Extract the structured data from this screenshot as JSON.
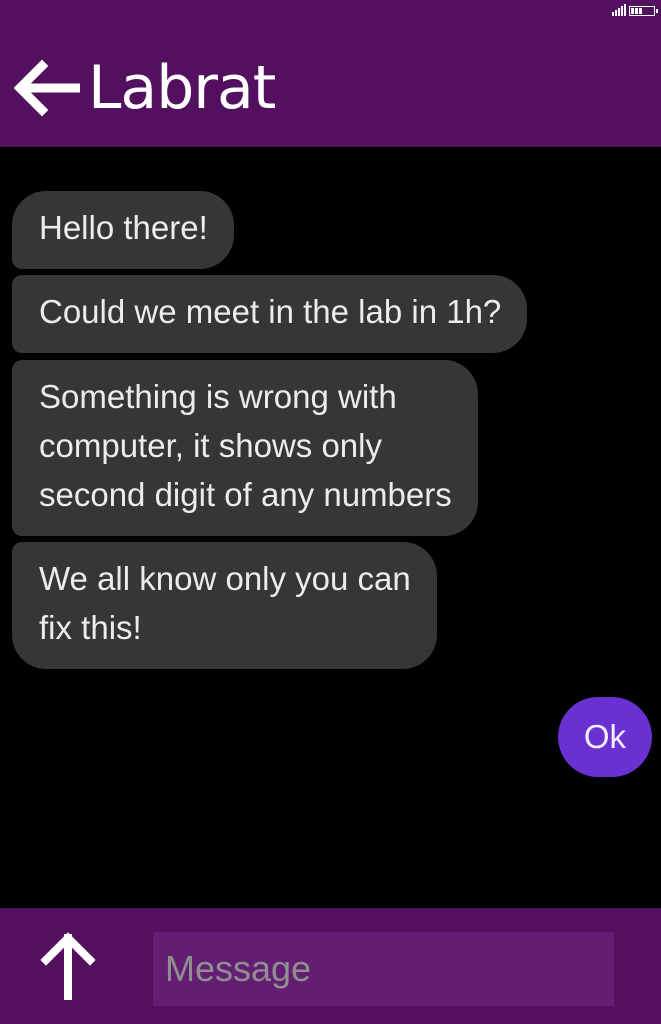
{
  "header": {
    "title": "Labrat",
    "back_icon": "arrow-left-icon",
    "status": {
      "signal_icon": "signal-bars-icon",
      "battery_icon": "battery-icon"
    }
  },
  "chat": {
    "incoming": [
      {
        "lines": [
          "Hello there!"
        ]
      },
      {
        "lines": [
          "Could we meet in the lab in 1h?"
        ]
      },
      {
        "lines": [
          "Something is wrong with",
          "computer, it shows only",
          "second digit of any numbers"
        ]
      },
      {
        "lines": [
          "We all know only you can",
          "fix this!"
        ]
      }
    ],
    "outgoing": [
      {
        "text": "Ok"
      }
    ]
  },
  "composer": {
    "send_icon": "arrow-up-icon",
    "placeholder": "Message",
    "value": ""
  },
  "colors": {
    "header_bg": "#53105f",
    "footer_bg": "#53105f",
    "input_bg": "#631e73",
    "incoming_bubble": "#363636",
    "outgoing_bubble": "#6a30d2",
    "chat_bg": "#000000"
  }
}
